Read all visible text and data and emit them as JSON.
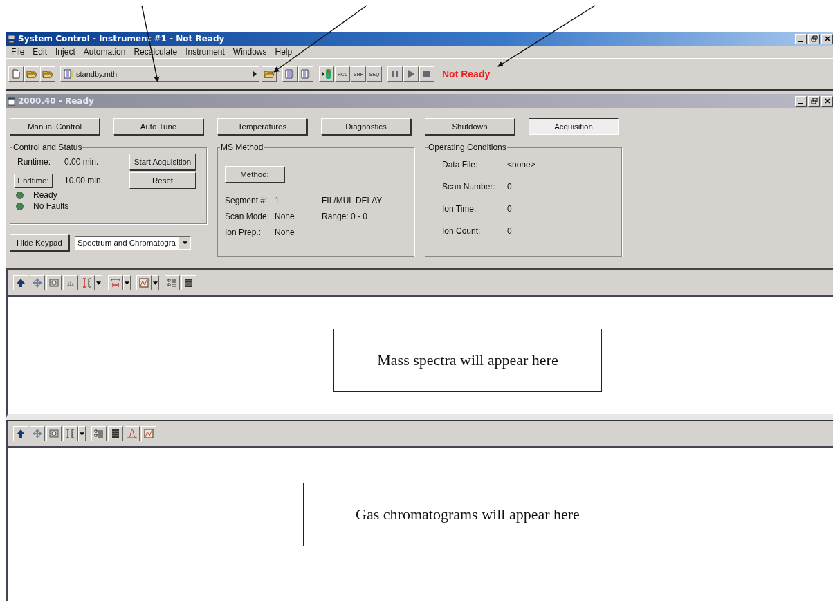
{
  "window": {
    "title": "System Control - Instrument #1 - Not Ready"
  },
  "menu": [
    {
      "label": "File"
    },
    {
      "label": "Edit"
    },
    {
      "label": "Inject"
    },
    {
      "label": "Automation"
    },
    {
      "label": "Recalculate"
    },
    {
      "label": "Instrument"
    },
    {
      "label": "Windows"
    },
    {
      "label": "Help"
    }
  ],
  "toolbar": {
    "method_file": "standby.mth",
    "run_buttons": [
      "RCL",
      "SHP",
      "SEQ"
    ],
    "status": "Not Ready"
  },
  "child_window": {
    "title": "2000.40 - Ready"
  },
  "mode_buttons": [
    {
      "label": "Manual Control",
      "selected": false
    },
    {
      "label": "Auto Tune",
      "selected": false
    },
    {
      "label": "Temperatures",
      "selected": false
    },
    {
      "label": "Diagnostics",
      "selected": false
    },
    {
      "label": "Shutdown",
      "selected": false
    },
    {
      "label": "Acquisition",
      "selected": true
    }
  ],
  "control_and_status": {
    "title": "Control and Status",
    "runtime_label": "Runtime:",
    "runtime": "0.00 min.",
    "endtime_button": "Endtime:",
    "endtime": "10.00 min.",
    "start_button": "Start Acquisition",
    "reset_button": "Reset",
    "lights": [
      {
        "label": "Ready",
        "on": true
      },
      {
        "label": "No Faults",
        "on": true
      }
    ]
  },
  "hide_keypad_button": "Hide Keypad",
  "view_select": {
    "value": "Spectrum and Chromatogra"
  },
  "ms_method": {
    "title": "MS Method",
    "method_button": "Method:",
    "rows": [
      {
        "label": "Segment #:",
        "value": "1",
        "extra": "FIL/MUL DELAY"
      },
      {
        "label": "Scan Mode:",
        "value": "None",
        "extra": "Range: 0 - 0"
      },
      {
        "label": "Ion Prep.:",
        "value": "None"
      }
    ]
  },
  "operating_conditions": {
    "title": "Operating Conditions",
    "rows": [
      {
        "label": "Data File:",
        "value": "<none>"
      },
      {
        "label": "Scan Number:",
        "value": "0"
      },
      {
        "label": "Ion Time:",
        "value": "0"
      },
      {
        "label": "Ion Count:",
        "value": "0"
      }
    ]
  },
  "spectrum_pane": {
    "note": "Mass spectra will appear here"
  },
  "chromatogram_pane": {
    "note": "Gas chromatograms will appear here"
  }
}
